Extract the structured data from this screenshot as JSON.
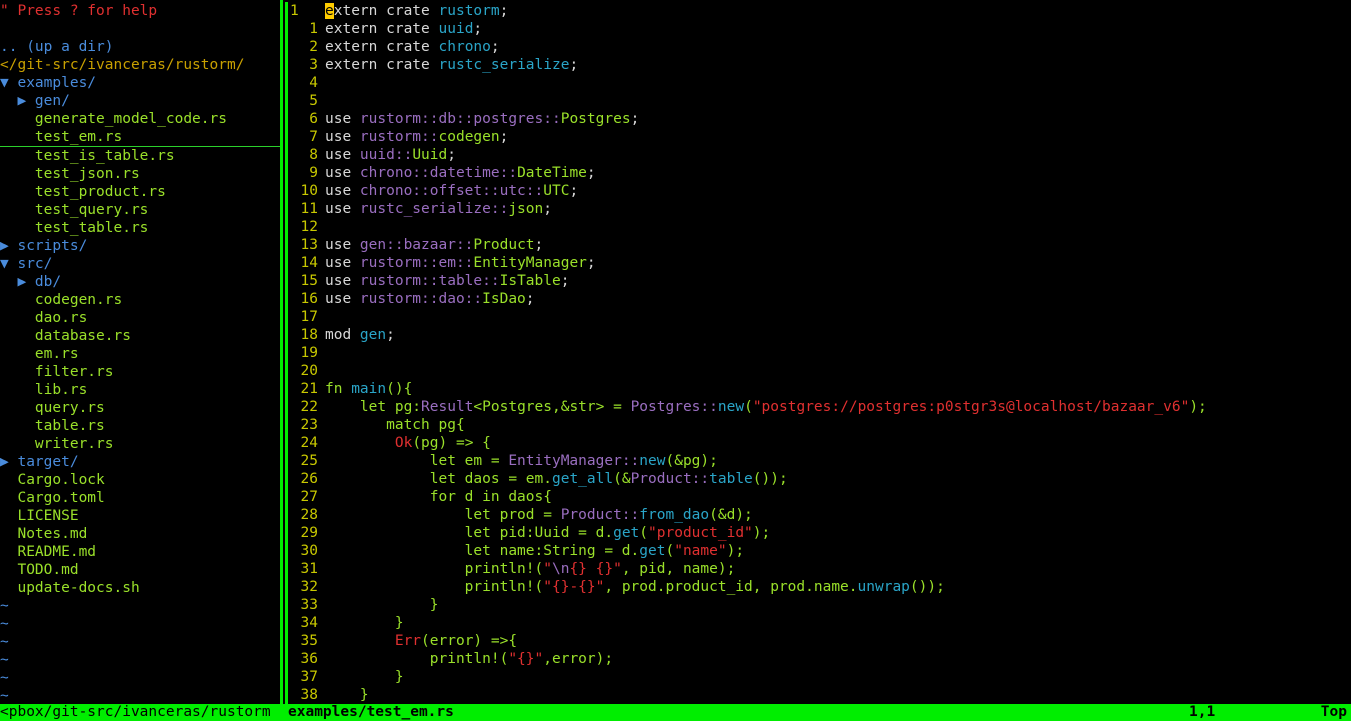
{
  "colors": {
    "keyword": "#d8d8d8",
    "crate": "#2aa5c8",
    "path": "#9a6ec0",
    "type": "#9ae02a",
    "string": "#e03030",
    "fn_call": "#2aa5c8",
    "plain": "#d8d8d8",
    "linenr": "#c8c800",
    "split": "#00ee00"
  },
  "tree": [
    {
      "text": "\" Press ? for help",
      "kind": "help"
    },
    {
      "text": "",
      "kind": "blank"
    },
    {
      "text": ".. (up a dir)",
      "kind": "updir"
    },
    {
      "text": "</git-src/ivanceras/rustorm/",
      "kind": "cwd"
    },
    {
      "text": "▼ examples/",
      "kind": "dir",
      "indent": 0
    },
    {
      "text": "▶ gen/",
      "kind": "dir",
      "indent": 1
    },
    {
      "text": "generate_model_code.rs",
      "kind": "file",
      "indent": 2
    },
    {
      "text": "test_em.rs",
      "kind": "file",
      "indent": 2,
      "current": true
    },
    {
      "text": "test_is_table.rs",
      "kind": "file",
      "indent": 2
    },
    {
      "text": "test_json.rs",
      "kind": "file",
      "indent": 2
    },
    {
      "text": "test_product.rs",
      "kind": "file",
      "indent": 2
    },
    {
      "text": "test_query.rs",
      "kind": "file",
      "indent": 2
    },
    {
      "text": "test_table.rs",
      "kind": "file",
      "indent": 2
    },
    {
      "text": "▶ scripts/",
      "kind": "dir",
      "indent": 0
    },
    {
      "text": "▼ src/",
      "kind": "dir",
      "indent": 0
    },
    {
      "text": "▶ db/",
      "kind": "dir",
      "indent": 1
    },
    {
      "text": "codegen.rs",
      "kind": "file",
      "indent": 2
    },
    {
      "text": "dao.rs",
      "kind": "file",
      "indent": 2
    },
    {
      "text": "database.rs",
      "kind": "file",
      "indent": 2
    },
    {
      "text": "em.rs",
      "kind": "file",
      "indent": 2
    },
    {
      "text": "filter.rs",
      "kind": "file",
      "indent": 2
    },
    {
      "text": "lib.rs",
      "kind": "file",
      "indent": 2
    },
    {
      "text": "query.rs",
      "kind": "file",
      "indent": 2
    },
    {
      "text": "table.rs",
      "kind": "file",
      "indent": 2
    },
    {
      "text": "writer.rs",
      "kind": "file",
      "indent": 2
    },
    {
      "text": "▶ target/",
      "kind": "dir",
      "indent": 0
    },
    {
      "text": "Cargo.lock",
      "kind": "file",
      "indent": 1
    },
    {
      "text": "Cargo.toml",
      "kind": "file",
      "indent": 1
    },
    {
      "text": "LICENSE",
      "kind": "file",
      "indent": 1
    },
    {
      "text": "Notes.md",
      "kind": "file",
      "indent": 1
    },
    {
      "text": "README.md",
      "kind": "file",
      "indent": 1
    },
    {
      "text": "TODO.md",
      "kind": "file",
      "indent": 1
    },
    {
      "text": "update-docs.sh",
      "kind": "file",
      "indent": 1
    },
    {
      "text": "~",
      "kind": "tilde"
    },
    {
      "text": "~",
      "kind": "tilde"
    },
    {
      "text": "~",
      "kind": "tilde"
    },
    {
      "text": "~",
      "kind": "tilde"
    },
    {
      "text": "~",
      "kind": "tilde"
    },
    {
      "text": "~",
      "kind": "tilde"
    }
  ],
  "code": [
    {
      "nr": "1",
      "first": true,
      "tokens": [
        [
          "cur",
          "e"
        ],
        [
          "kw",
          "xtern crate "
        ],
        [
          "crate",
          "rustorm"
        ],
        [
          "p",
          ";"
        ]
      ]
    },
    {
      "nr": "1",
      "tokens": [
        [
          "kw",
          "extern crate "
        ],
        [
          "crate",
          "uuid"
        ],
        [
          "p",
          ";"
        ]
      ]
    },
    {
      "nr": "2",
      "tokens": [
        [
          "kw",
          "extern crate "
        ],
        [
          "crate",
          "chrono"
        ],
        [
          "p",
          ";"
        ]
      ]
    },
    {
      "nr": "3",
      "tokens": [
        [
          "kw",
          "extern crate "
        ],
        [
          "crate",
          "rustc_serialize"
        ],
        [
          "p",
          ";"
        ]
      ]
    },
    {
      "nr": "4",
      "tokens": []
    },
    {
      "nr": "5",
      "tokens": []
    },
    {
      "nr": "6",
      "tokens": [
        [
          "kw",
          "use "
        ],
        [
          "path",
          "rustorm::db::postgres::"
        ],
        [
          "type",
          "Postgres"
        ],
        [
          "p",
          ";"
        ]
      ]
    },
    {
      "nr": "7",
      "tokens": [
        [
          "kw",
          "use "
        ],
        [
          "path",
          "rustorm::"
        ],
        [
          "type",
          "codegen"
        ],
        [
          "p",
          ";"
        ]
      ]
    },
    {
      "nr": "8",
      "tokens": [
        [
          "kw",
          "use "
        ],
        [
          "path",
          "uuid::"
        ],
        [
          "type",
          "Uuid"
        ],
        [
          "p",
          ";"
        ]
      ]
    },
    {
      "nr": "9",
      "tokens": [
        [
          "kw",
          "use "
        ],
        [
          "path",
          "chrono::datetime::"
        ],
        [
          "type",
          "DateTime"
        ],
        [
          "p",
          ";"
        ]
      ]
    },
    {
      "nr": "10",
      "tokens": [
        [
          "kw",
          "use "
        ],
        [
          "path",
          "chrono::offset::utc::"
        ],
        [
          "type",
          "UTC"
        ],
        [
          "p",
          ";"
        ]
      ]
    },
    {
      "nr": "11",
      "tokens": [
        [
          "kw",
          "use "
        ],
        [
          "path",
          "rustc_serialize::"
        ],
        [
          "type",
          "json"
        ],
        [
          "p",
          ";"
        ]
      ]
    },
    {
      "nr": "12",
      "tokens": []
    },
    {
      "nr": "13",
      "tokens": [
        [
          "kw",
          "use "
        ],
        [
          "path",
          "gen::bazaar::"
        ],
        [
          "type",
          "Product"
        ],
        [
          "p",
          ";"
        ]
      ]
    },
    {
      "nr": "14",
      "tokens": [
        [
          "kw",
          "use "
        ],
        [
          "path",
          "rustorm::em::"
        ],
        [
          "type",
          "EntityManager"
        ],
        [
          "p",
          ";"
        ]
      ]
    },
    {
      "nr": "15",
      "tokens": [
        [
          "kw",
          "use "
        ],
        [
          "path",
          "rustorm::table::"
        ],
        [
          "type",
          "IsTable"
        ],
        [
          "p",
          ";"
        ]
      ]
    },
    {
      "nr": "16",
      "tokens": [
        [
          "kw",
          "use "
        ],
        [
          "path",
          "rustorm::dao::"
        ],
        [
          "type",
          "IsDao"
        ],
        [
          "p",
          ";"
        ]
      ]
    },
    {
      "nr": "17",
      "tokens": []
    },
    {
      "nr": "18",
      "tokens": [
        [
          "kw",
          "mod "
        ],
        [
          "crate",
          "gen"
        ],
        [
          "p",
          ";"
        ]
      ]
    },
    {
      "nr": "19",
      "tokens": []
    },
    {
      "nr": "20",
      "tokens": []
    },
    {
      "nr": "21",
      "tokens": [
        [
          "type",
          "fn "
        ],
        [
          "crate",
          "main"
        ],
        [
          "type",
          "(){"
        ]
      ]
    },
    {
      "nr": "22",
      "tokens": [
        [
          "type",
          "    let pg:"
        ],
        [
          "path",
          "Result"
        ],
        [
          "type",
          "<Postgres,&str> = "
        ],
        [
          "path",
          "Postgres::"
        ],
        [
          "crate",
          "new"
        ],
        [
          "type",
          "("
        ],
        [
          "str",
          "\"postgres://postgres:p0stgr3s@localhost/bazaar_v6\""
        ],
        [
          "type",
          ");"
        ]
      ]
    },
    {
      "nr": "23",
      "tokens": [
        [
          "type",
          "       match pg{"
        ]
      ]
    },
    {
      "nr": "24",
      "tokens": [
        [
          "type",
          "        "
        ],
        [
          "str",
          "Ok"
        ],
        [
          "type",
          "(pg) => {"
        ]
      ]
    },
    {
      "nr": "25",
      "tokens": [
        [
          "type",
          "            let em = "
        ],
        [
          "path",
          "EntityManager::"
        ],
        [
          "crate",
          "new"
        ],
        [
          "type",
          "(&pg);"
        ]
      ]
    },
    {
      "nr": "26",
      "tokens": [
        [
          "type",
          "            let daos = em."
        ],
        [
          "crate",
          "get_all"
        ],
        [
          "type",
          "(&"
        ],
        [
          "path",
          "Product::"
        ],
        [
          "crate",
          "table"
        ],
        [
          "type",
          "());"
        ]
      ]
    },
    {
      "nr": "27",
      "tokens": [
        [
          "type",
          "            for d in daos{"
        ]
      ]
    },
    {
      "nr": "28",
      "tokens": [
        [
          "type",
          "                let prod = "
        ],
        [
          "path",
          "Product::"
        ],
        [
          "crate",
          "from_dao"
        ],
        [
          "type",
          "(&d);"
        ]
      ]
    },
    {
      "nr": "29",
      "tokens": [
        [
          "type",
          "                let pid:Uuid = d."
        ],
        [
          "crate",
          "get"
        ],
        [
          "type",
          "("
        ],
        [
          "str",
          "\"product_id\""
        ],
        [
          "type",
          ");"
        ]
      ]
    },
    {
      "nr": "30",
      "tokens": [
        [
          "type",
          "                let name:String = d."
        ],
        [
          "crate",
          "get"
        ],
        [
          "type",
          "("
        ],
        [
          "str",
          "\"name\""
        ],
        [
          "type",
          ");"
        ]
      ]
    },
    {
      "nr": "31",
      "tokens": [
        [
          "type",
          "                println!("
        ],
        [
          "str",
          "\""
        ],
        [
          "path",
          "\\n"
        ],
        [
          "str",
          "{} {}\""
        ],
        [
          "type",
          ", pid, name);"
        ]
      ]
    },
    {
      "nr": "32",
      "tokens": [
        [
          "type",
          "                println!("
        ],
        [
          "str",
          "\"{}-{}\""
        ],
        [
          "type",
          ", prod.product_id, prod.name."
        ],
        [
          "crate",
          "unwrap"
        ],
        [
          "type",
          "());"
        ]
      ]
    },
    {
      "nr": "33",
      "tokens": [
        [
          "type",
          "            }"
        ]
      ]
    },
    {
      "nr": "34",
      "tokens": [
        [
          "type",
          "        }"
        ]
      ]
    },
    {
      "nr": "35",
      "tokens": [
        [
          "type",
          "        "
        ],
        [
          "str",
          "Err"
        ],
        [
          "type",
          "(error) =>{"
        ]
      ]
    },
    {
      "nr": "36",
      "tokens": [
        [
          "type",
          "            println!("
        ],
        [
          "str",
          "\"{}\""
        ],
        [
          "type",
          ",error);"
        ]
      ]
    },
    {
      "nr": "37",
      "tokens": [
        [
          "type",
          "        }"
        ]
      ]
    },
    {
      "nr": "38",
      "tokens": [
        [
          "type",
          "    }"
        ]
      ]
    }
  ],
  "status": {
    "left": "<pbox/git-src/ivanceras/rustorm",
    "file": "examples/test_em.rs",
    "position": "1,1",
    "scroll": "Top"
  }
}
